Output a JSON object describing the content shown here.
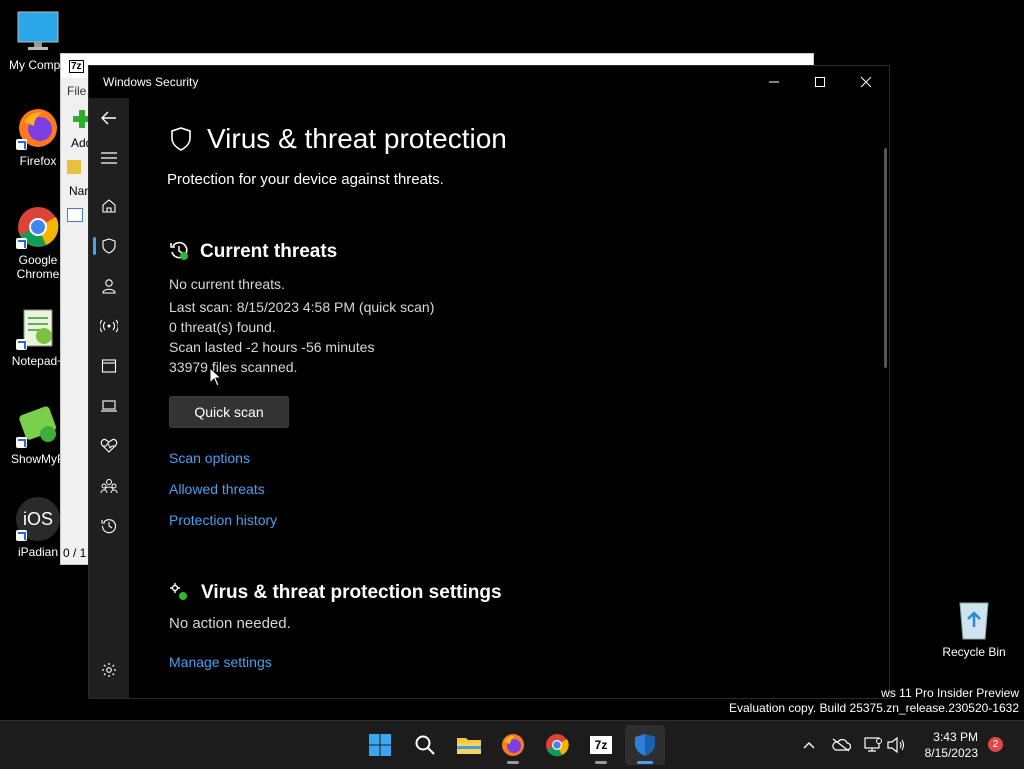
{
  "desktop": {
    "icons": [
      {
        "label": "My Compu",
        "icon": "computer-icon"
      },
      {
        "label": "Firefox",
        "icon": "firefox-icon"
      },
      {
        "label": "Google\nChrome",
        "icon": "chrome-icon"
      },
      {
        "label": "Notepad+",
        "icon": "notepad-plus-icon"
      },
      {
        "label": "ShowMyP",
        "icon": "showmypc-icon"
      },
      {
        "label": "iPadian",
        "icon": "ipadian-icon"
      },
      {
        "label": "Recycle Bin",
        "icon": "recycle-bin-icon"
      }
    ],
    "ios_text": "iOS"
  },
  "background_window": {
    "title_fragment": "7z",
    "menu_file": "File",
    "add_label": "Add",
    "name_header": "Nar",
    "status_text": "0 / 1"
  },
  "security_window": {
    "title": "Windows Security",
    "heading": "Virus & threat protection",
    "subtitle": "Protection for your device against threats.",
    "current_threats": {
      "heading": "Current threats",
      "status": "No current threats.",
      "last_scan": "Last scan: 8/15/2023 4:58 PM (quick scan)",
      "threats_found": "0 threat(s) found.",
      "scan_duration": "Scan lasted -2 hours -56 minutes",
      "files_scanned": "33979 files scanned.",
      "quick_scan_button": "Quick scan",
      "links": [
        "Scan options",
        "Allowed threats",
        "Protection history"
      ]
    },
    "settings": {
      "heading": "Virus & threat protection settings",
      "status": "No action needed.",
      "manage_link": "Manage settings"
    },
    "nav_icons": [
      "back-arrow-icon",
      "hamburger-menu-icon",
      "home-icon",
      "shield-icon",
      "account-icon",
      "firewall-network-icon",
      "app-browser-control-icon",
      "device-security-icon",
      "device-health-icon",
      "family-options-icon",
      "protection-history-icon",
      "settings-gear-icon"
    ]
  },
  "watermark": {
    "line1": "ws 11 Pro Insider Preview",
    "line2": "Evaluation copy. Build 25375.zn_release.230520-1632"
  },
  "taskbar": {
    "apps": [
      "start-icon",
      "search-icon",
      "file-explorer-icon",
      "firefox-icon",
      "chrome-icon",
      "7zip-icon",
      "windows-security-icon"
    ],
    "seven_zip_text": "7z",
    "time": "3:43 PM",
    "date": "8/15/2023",
    "notification_count": "2"
  },
  "colors": {
    "accent": "#4aa0f0",
    "sidebar": "#1f1f1f",
    "button": "#333333"
  }
}
